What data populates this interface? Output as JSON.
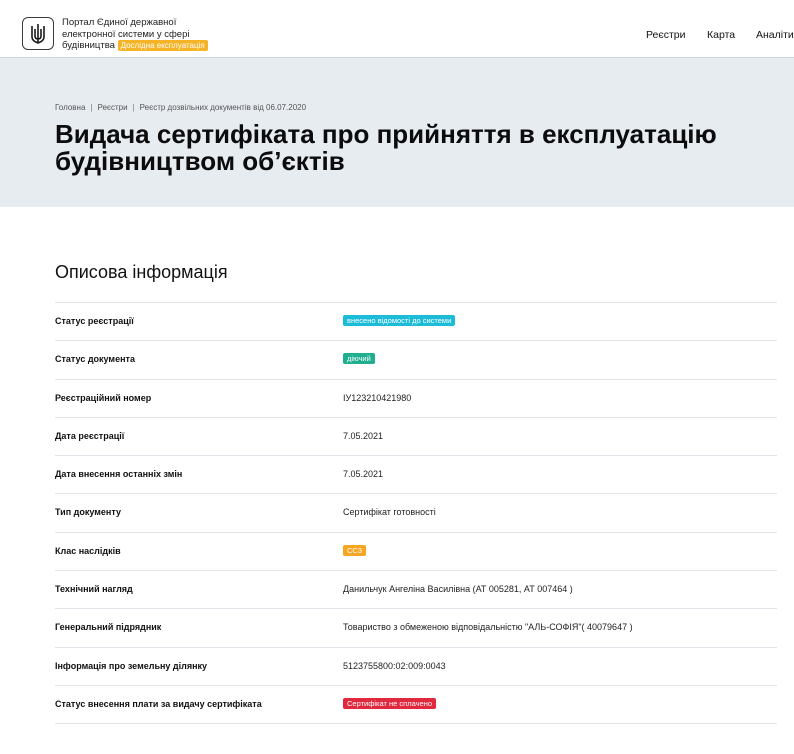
{
  "header": {
    "title_line1": "Портал Єдиної державної",
    "title_line2": "електронної системи у сфері",
    "title_line3": "будівництва",
    "beta_badge": "Дослідна експлуатація",
    "nav": [
      "Реєстри",
      "Карта",
      "Аналіти"
    ]
  },
  "breadcrumb": [
    "Головна",
    "Реєстри",
    "Реєстр дозвільних документів від 06.07.2020"
  ],
  "page_title_line1": "Видача сертифіката про прийняття в експлуатацію",
  "page_title_line2": "будівництвом об’єктів",
  "section_title": "Описова інформація",
  "colors": {
    "cyan": "#1cbcd8",
    "green": "#1fae8e",
    "orange": "#f5a623",
    "red": "#e0283f"
  },
  "rows": [
    {
      "label": "Статус реєстрації",
      "value": "внесено відомості до системи"
    },
    {
      "label": "Статус документа",
      "value": "діючий"
    },
    {
      "label": "Реєстраційний номер",
      "value": "ІУ123210421980"
    },
    {
      "label": "Дата реєстрації",
      "value": "7.05.2021"
    },
    {
      "label": "Дата внесення останніх змін",
      "value": "7.05.2021"
    },
    {
      "label": "Тип документу",
      "value": "Сертифікат готовності"
    },
    {
      "label": "Клас наслідків",
      "value": "СС3"
    },
    {
      "label": "Технічний нагляд",
      "value": "Данильчук Ангеліна Василівна (АТ 005281, АТ 007464 )"
    },
    {
      "label": "Генеральний підрядник",
      "value": "Товариство з обмеженою відповідальністю \"АЛЬ-СОФІЯ\"( 40079647 )"
    },
    {
      "label": "Інформація про земельну ділянку",
      "value": "5123755800:02:009:0043"
    },
    {
      "label": "Статус внесення плати за видачу сертифіката",
      "value": "Сертифікат не сплачено"
    }
  ]
}
